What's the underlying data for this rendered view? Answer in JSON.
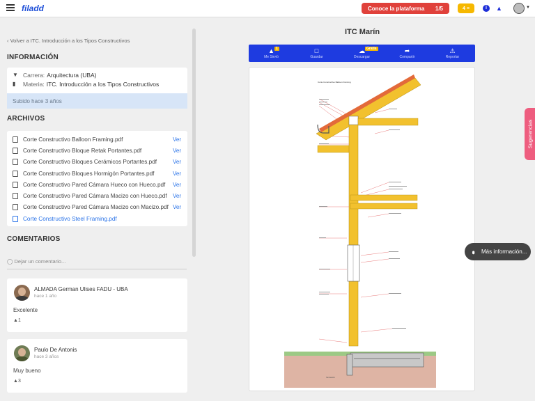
{
  "header": {
    "logo": "filadd",
    "promo_label": "Conoce la plataforma",
    "promo_progress": "1/5",
    "coins": "4",
    "menu_icon": "hamburger-icon",
    "info_icon": "info-icon",
    "bell_icon": "bell-icon"
  },
  "sidebar": {
    "back_link": "Volver a ITC. Introducción a los Tipos Constructivos",
    "info_title": "INFORMACIÓN",
    "career_label": "Carrera:",
    "career_value": "Arquitectura (UBA)",
    "subject_label": "Materia:",
    "subject_value": "ITC. Introducción a los Tipos Constructivos",
    "uploaded": "Subido hace 3 años",
    "files_title": "ARCHIVOS",
    "files": [
      {
        "name": "Corte Constructivo Balloon Framing.pdf",
        "action": "Ver"
      },
      {
        "name": "Corte Constructivo Bloque Retak Portantes.pdf",
        "action": "Ver"
      },
      {
        "name": "Corte Constructivo Bloques Cerámicos Portantes.pdf",
        "action": "Ver"
      },
      {
        "name": "Corte Constructivo Bloques Hormigón Portantes.pdf",
        "action": "Ver"
      },
      {
        "name": "Corte Constructivo Pared Cámara Hueco con Hueco.pdf",
        "action": "Ver"
      },
      {
        "name": "Corte Constructivo Pared Cámara Macizo con Hueco.pdf",
        "action": "Ver"
      },
      {
        "name": "Corte Constructivo Pared Cámara Macizo con Macizo.pdf",
        "action": "Ver"
      },
      {
        "name": "Corte Constructivo Steel Framing.pdf",
        "action": ""
      }
    ],
    "comments_title": "COMENTARIOS",
    "comment_placeholder": "Dejar un comentario...",
    "comments": [
      {
        "author": "ALMADA German Ulises FADU - UBA",
        "time": "hace 1 año",
        "text": "Excelente",
        "likes": "1"
      },
      {
        "author": "Paulo De Antonis",
        "time": "hace 3 años",
        "text": "Muy bueno",
        "likes": "3"
      }
    ]
  },
  "document": {
    "title": "ITC Marín",
    "actions": [
      {
        "label": "Me Sirvió",
        "icon": "thumbs-up-icon",
        "badge": "1"
      },
      {
        "label": "Guardar",
        "icon": "bookmark-icon",
        "badge": ""
      },
      {
        "label": "Descargar",
        "icon": "download-cloud-icon",
        "badge": "Gratis"
      },
      {
        "label": "Compartir",
        "icon": "share-icon",
        "badge": ""
      },
      {
        "label": "Reportar",
        "icon": "warning-icon",
        "badge": ""
      }
    ],
    "preview_caption": "Corte Constructivo Balloon Framing",
    "preview_footer": "fundación"
  },
  "floating": {
    "suggestions": "Sugerencias",
    "more_info": "Más información..."
  },
  "colors": {
    "brand_blue": "#1e3be0",
    "promo_red": "#e0413b",
    "coin_yellow": "#f6b800",
    "suggestion_pink": "#ee5d7f",
    "link_blue": "#2a73e8"
  }
}
